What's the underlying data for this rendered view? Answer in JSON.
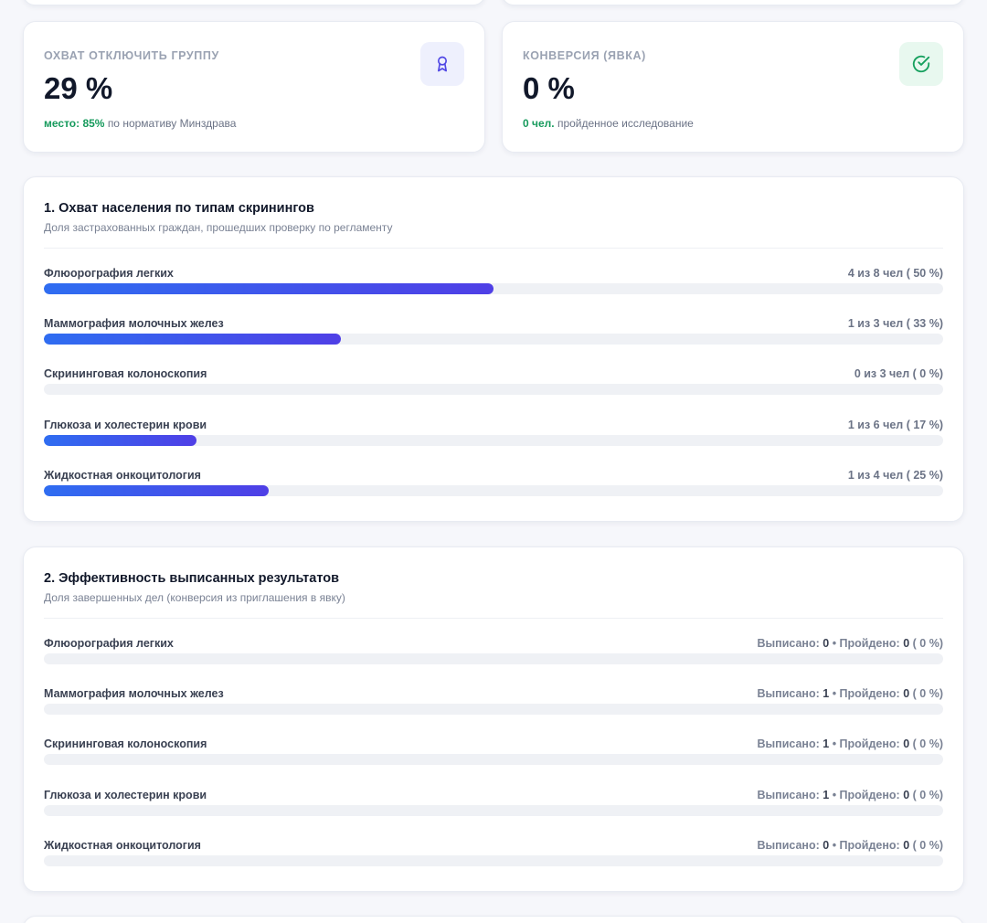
{
  "stats": {
    "coverage": {
      "label": "ОХВАТ ОТКЛЮЧИТЬ ГРУППУ",
      "value": "29 %",
      "foot_accent": "место: 85%",
      "foot_text": "по нормативу Минздрава",
      "icon": "award-icon",
      "accent_color": "#169a5c"
    },
    "conversion": {
      "label": "КОНВЕРСИЯ (ЯВКА)",
      "value": "0 %",
      "foot_accent": "0 чел.",
      "foot_text": "пройденное исследование",
      "icon": "check-circle-icon",
      "accent_color": "#169a5c"
    }
  },
  "coverage_section": {
    "title": "1. Охват населения по типам скринингов",
    "subtitle": "Доля застрахованных граждан, прошедших проверку по регламенту",
    "rows": [
      {
        "label": "Флюорография легких",
        "value": "4 из 8 чел ( 50 %)",
        "percent": 50
      },
      {
        "label": "Маммография молочных желез",
        "value": "1 из 3 чел ( 33 %)",
        "percent": 33
      },
      {
        "label": "Скрининговая колоноскопия",
        "value": "0 из 3 чел ( 0 %)",
        "percent": 0
      },
      {
        "label": "Глюкоза и холестерин крови",
        "value": "1 из 6 чел ( 17 %)",
        "percent": 17
      },
      {
        "label": "Жидкостная онкоцитология",
        "value": "1 из 4 чел ( 25 %)",
        "percent": 25
      }
    ]
  },
  "efficiency_section": {
    "title": "2. Эффективность выписанных результатов",
    "subtitle": "Доля завершенных дел (конверсия из приглашения в явку)",
    "issued_label": "Выписано:",
    "passed_label": "Пройдено:",
    "rows": [
      {
        "label": "Флюорография легких",
        "issued": "0",
        "passed": "0",
        "pct_text": "( 0 %)",
        "percent": 0
      },
      {
        "label": "Маммография молочных желез",
        "issued": "1",
        "passed": "0",
        "pct_text": "( 0 %)",
        "percent": 0
      },
      {
        "label": "Скрининговая колоноскопия",
        "issued": "1",
        "passed": "0",
        "pct_text": "( 0 %)",
        "percent": 0
      },
      {
        "label": "Глюкоза и холестерин крови",
        "issued": "1",
        "passed": "0",
        "pct_text": "( 0 %)",
        "percent": 0
      },
      {
        "label": "Жидкостная онкоцитология",
        "issued": "0",
        "passed": "0",
        "pct_text": "( 0 %)",
        "percent": 0
      }
    ]
  },
  "colors": {
    "bar_start": "#2f6df1",
    "bar_end": "#4f3fe6",
    "track": "#eff1f5"
  }
}
